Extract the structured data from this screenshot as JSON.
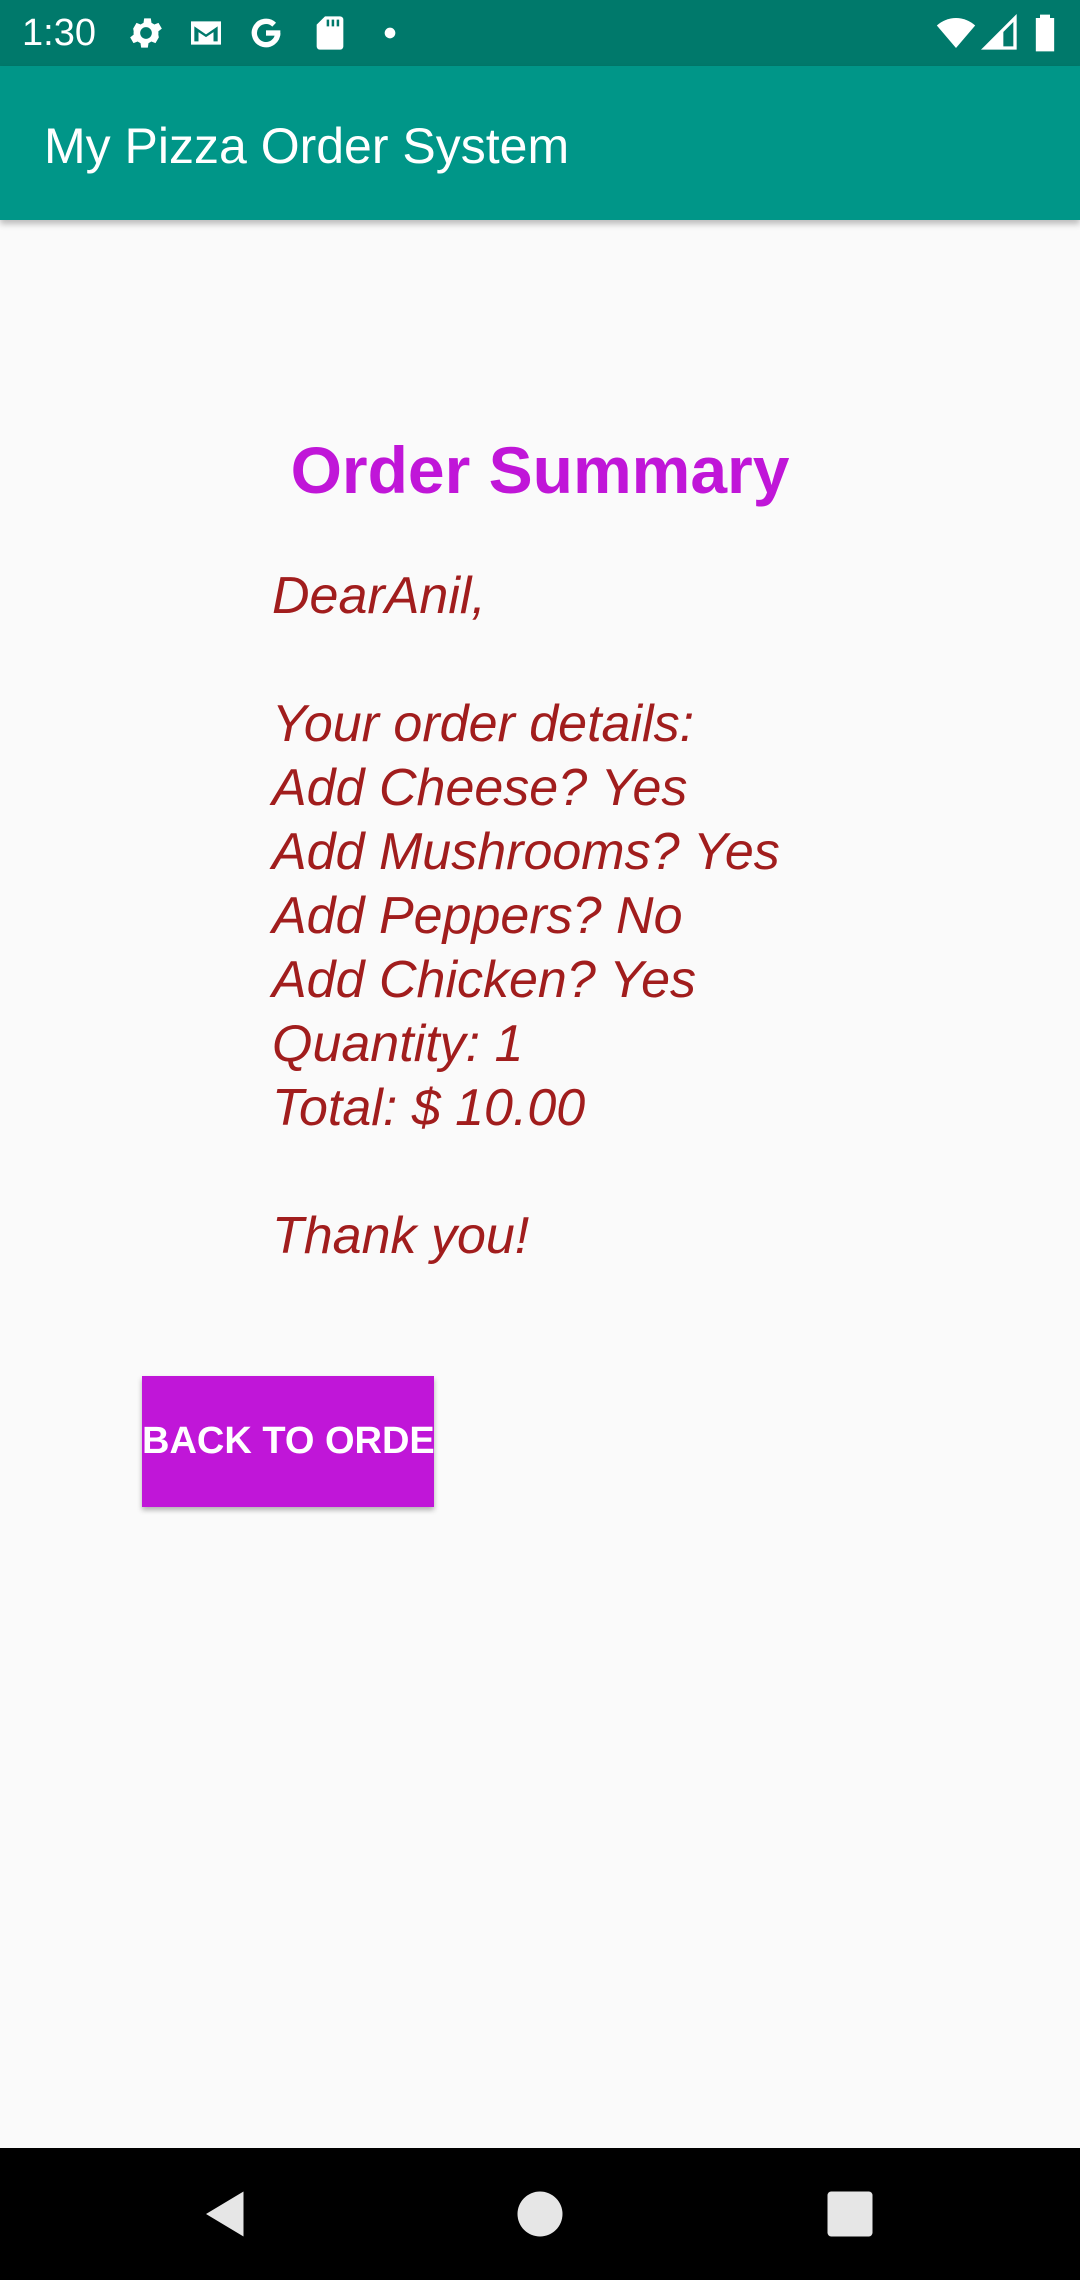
{
  "status_bar": {
    "time": "1:30",
    "left_icons": [
      "gear-icon",
      "gmail-icon",
      "google-icon",
      "sd-card-icon",
      "notification-dot-icon"
    ],
    "right_icons": [
      "wifi-icon",
      "signal-icon",
      "battery-icon"
    ]
  },
  "app_bar": {
    "title": "My Pizza Order System"
  },
  "summary": {
    "title": "Order Summary",
    "lines": [
      "DearAnil,",
      "",
      "Your order details:",
      "Add Cheese? Yes",
      "Add Mushrooms? Yes",
      "Add Peppers? No",
      "Add Chicken? Yes",
      "Quantity: 1",
      "Total: $ 10.00",
      "",
      "Thank you!"
    ]
  },
  "back_button": {
    "label": "BACK TO ORDER"
  },
  "nav_bar": {
    "buttons": [
      "back-icon",
      "home-icon",
      "recents-icon"
    ]
  },
  "colors": {
    "status_bar": "#00796b",
    "app_bar": "#009688",
    "accent_purple": "#c016d8",
    "body_text": "#a11d1d",
    "background": "#fafafa"
  }
}
